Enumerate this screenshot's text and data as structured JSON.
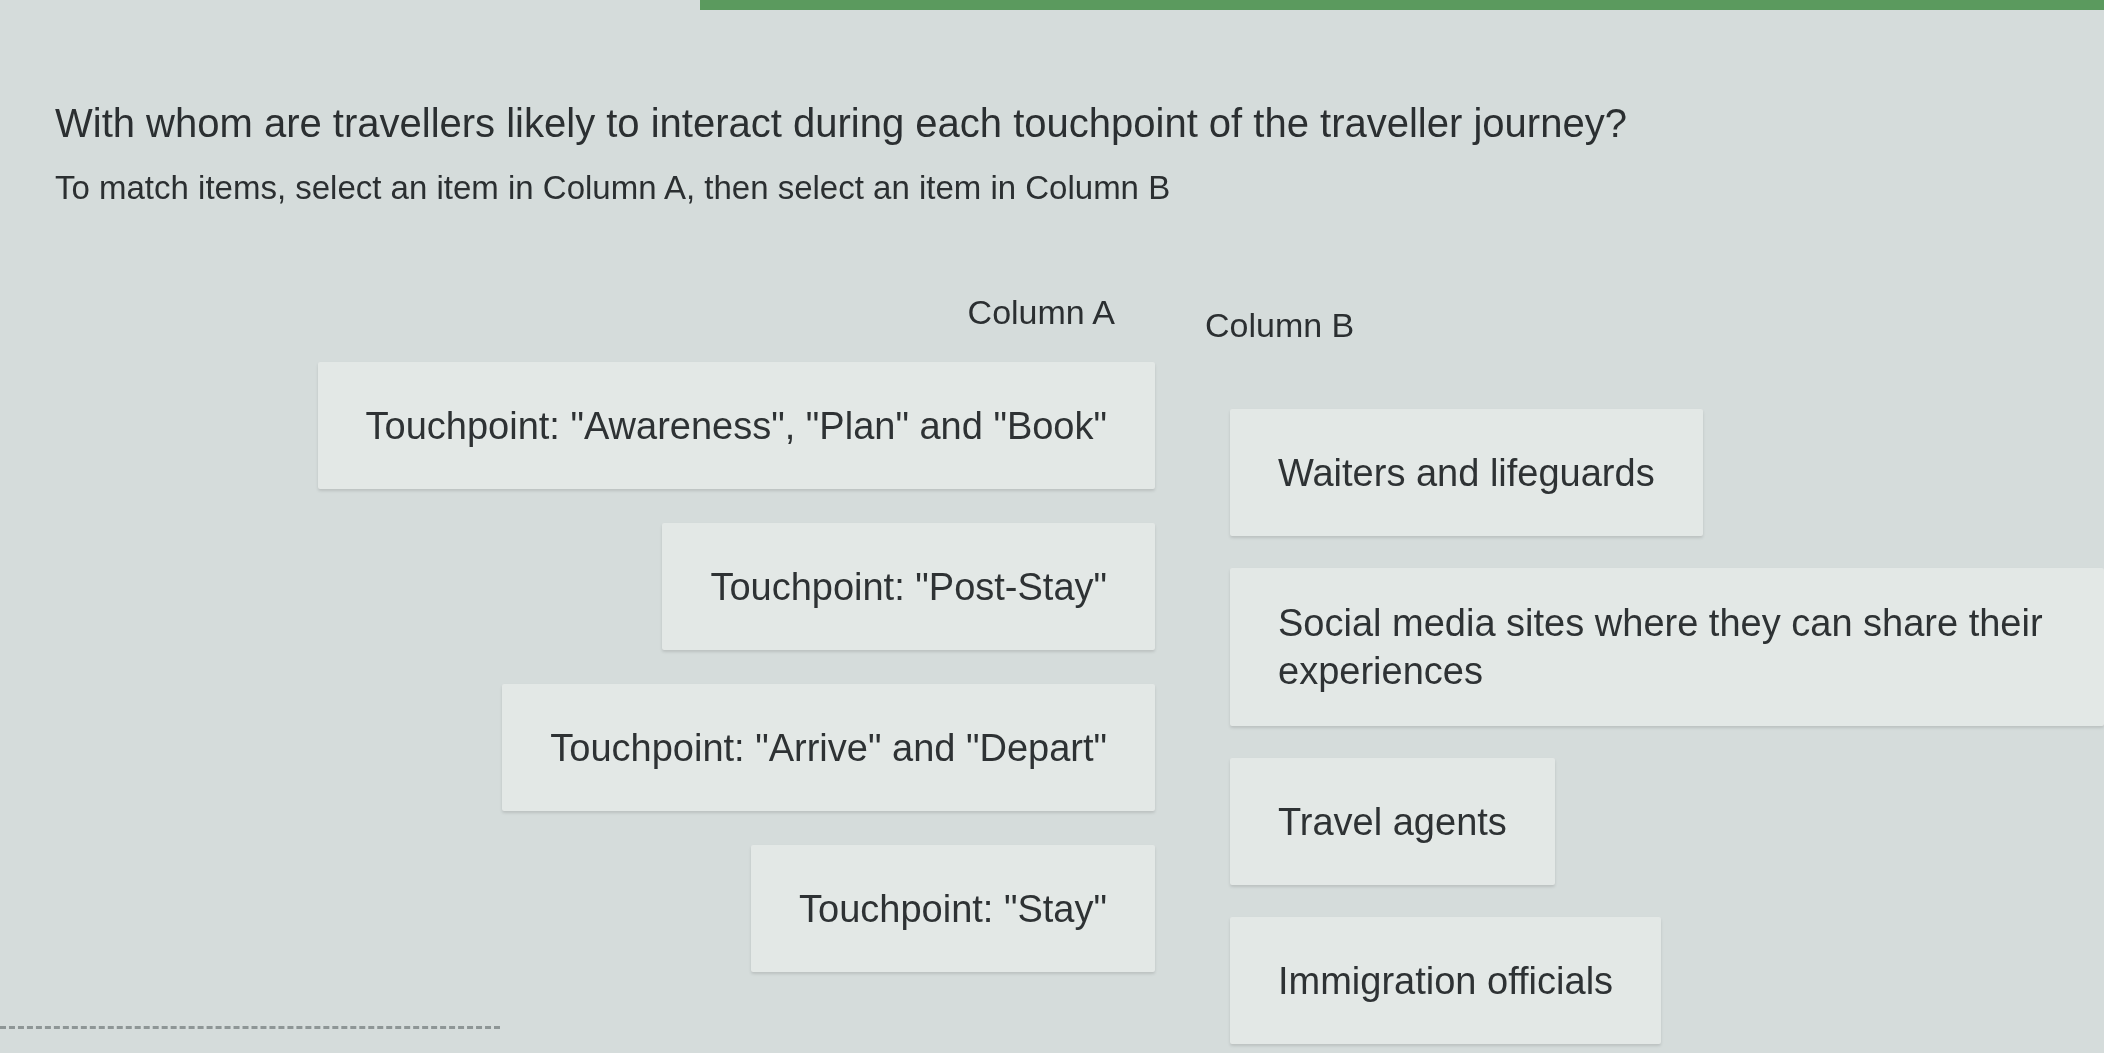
{
  "question": {
    "title": "With whom are travellers likely to interact during each touchpoint of the traveller journey?",
    "instructions": "To match items, select an item in Column A, then select an item in Column B"
  },
  "column_a": {
    "heading": "Column A",
    "items": [
      {
        "label": "Touchpoint: \"Awareness\", \"Plan\" and \"Book\"",
        "selected": false
      },
      {
        "label": "Touchpoint: \"Post-Stay\"",
        "selected": false
      },
      {
        "label": "Touchpoint: \"Arrive\" and \"Depart\"",
        "selected": false
      },
      {
        "label": "Touchpoint: \"Stay\"",
        "selected": false
      }
    ]
  },
  "column_b": {
    "heading": "Column B",
    "items": [
      {
        "label": "Waiters and lifeguards",
        "selected": false
      },
      {
        "label": "Social media sites where they can share their experiences",
        "selected": false
      },
      {
        "label": "Travel agents",
        "selected": false
      },
      {
        "label": "Immigration officials",
        "selected": false
      }
    ]
  }
}
